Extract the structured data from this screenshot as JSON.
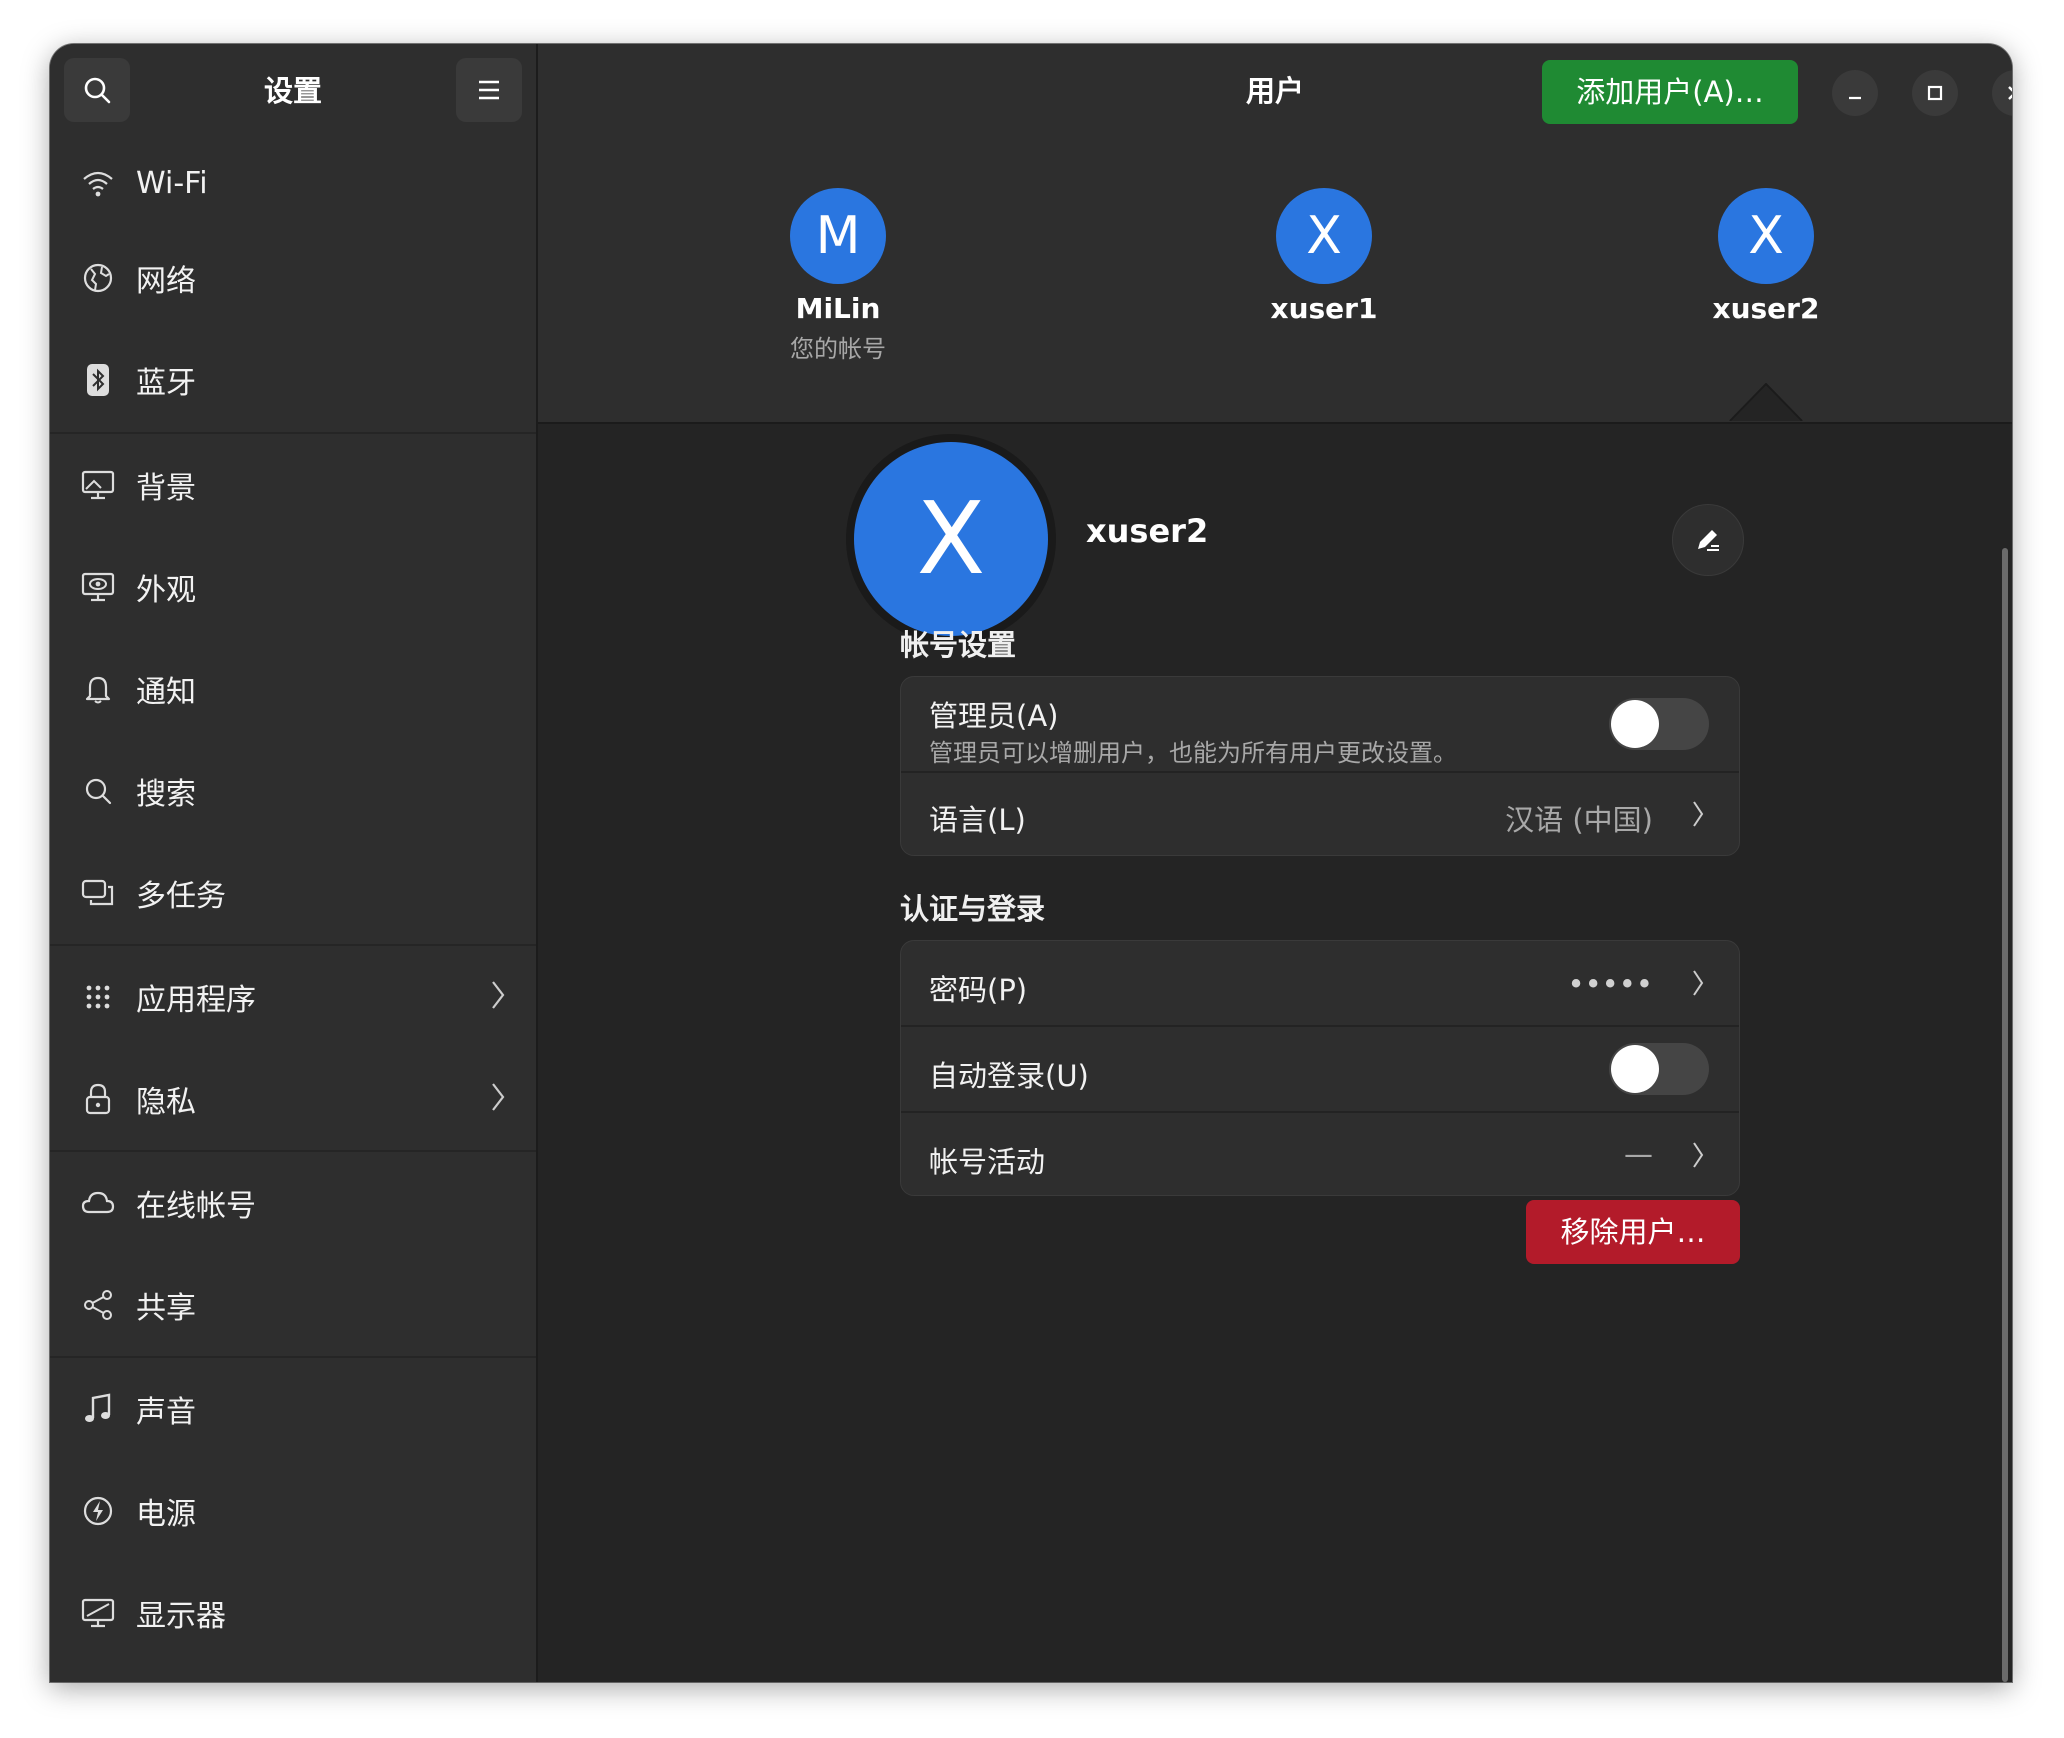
{
  "sidebar": {
    "title": "设置",
    "items": [
      {
        "label": "Wi-Fi",
        "icon": "wifi-icon"
      },
      {
        "label": "网络",
        "icon": "network-icon"
      },
      {
        "label": "蓝牙",
        "icon": "bluetooth-icon"
      },
      {
        "label": "背景",
        "icon": "background-icon"
      },
      {
        "label": "外观",
        "icon": "appearance-icon"
      },
      {
        "label": "通知",
        "icon": "bell-icon"
      },
      {
        "label": "搜索",
        "icon": "search-icon"
      },
      {
        "label": "多任务",
        "icon": "multitasking-icon"
      },
      {
        "label": "应用程序",
        "icon": "apps-grid-icon"
      },
      {
        "label": "隐私",
        "icon": "lock-icon"
      },
      {
        "label": "在线帐号",
        "icon": "cloud-icon"
      },
      {
        "label": "共享",
        "icon": "share-icon"
      },
      {
        "label": "声音",
        "icon": "music-note-icon"
      },
      {
        "label": "电源",
        "icon": "power-icon"
      },
      {
        "label": "显示器",
        "icon": "display-icon"
      }
    ]
  },
  "header": {
    "title": "用户",
    "add_user_label": "添加用户(A)…"
  },
  "users": [
    {
      "initial": "M",
      "name": "MiLin",
      "subtitle": "您的帐号"
    },
    {
      "initial": "X",
      "name": "xuser1"
    },
    {
      "initial": "X",
      "name": "xuser2"
    }
  ],
  "selected_user": {
    "initial": "X",
    "name": "xuser2"
  },
  "account_settings": {
    "heading": "帐号设置",
    "admin_title": "管理员(A)",
    "admin_subtitle": "管理员可以增删用户，也能为所有用户更改设置。",
    "admin_enabled": false,
    "language_title": "语言(L)",
    "language_value": "汉语 (中国)"
  },
  "auth": {
    "heading": "认证与登录",
    "password_title": "密码(P)",
    "password_value": "•••••",
    "autologin_title": "自动登录(U)",
    "autologin_enabled": false,
    "activity_title": "帐号活动",
    "activity_value": "—"
  },
  "remove_label": "移除用户…",
  "colors": {
    "accent_blue": "#2a76e0",
    "add_green": "#1f8a33",
    "remove_red": "#b31b2a"
  }
}
